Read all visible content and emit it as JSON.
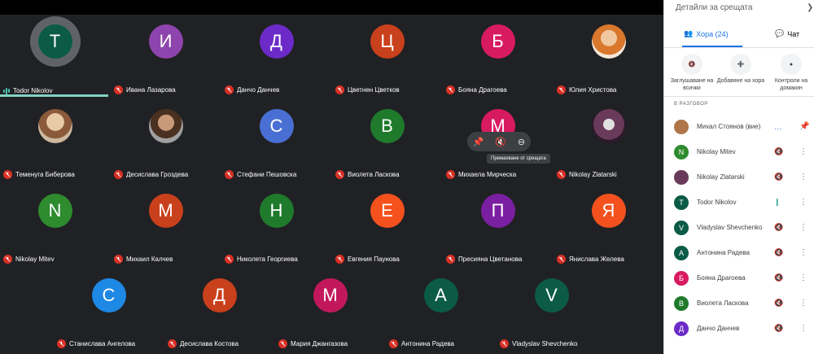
{
  "grid_tiles": [
    {
      "name": "Todor Nikolov",
      "letter": "T",
      "color": "#0b5b46",
      "speaking": true
    },
    {
      "name": "Ивана Лазарова",
      "letter": "И",
      "color": "#8e44ad",
      "speaking": false
    },
    {
      "name": "Данчо Данчев",
      "letter": "Д",
      "color": "#6c2bc8",
      "speaking": false
    },
    {
      "name": "Цветнен Цветков",
      "letter": "Ц",
      "color": "#c9401c",
      "speaking": false
    },
    {
      "name": "Бояна Драгоева",
      "letter": "Б",
      "color": "#d81b60",
      "speaking": false
    },
    {
      "name": "Юлия Христова",
      "photo": "p2",
      "speaking": false
    },
    {
      "name": "Теменуга Биберова",
      "photo": "p1",
      "speaking": false
    },
    {
      "name": "Десислава Гроздева",
      "photo": "p3",
      "speaking": false
    },
    {
      "name": "Стефани Пешовска",
      "letter": "С",
      "color": "#4a6fd4",
      "speaking": false
    },
    {
      "name": "Виолета Ласкова",
      "letter": "В",
      "color": "#1f7a2c",
      "speaking": false
    },
    {
      "name": "Михаела Мирческа",
      "letter": "М",
      "color": "#d81b60",
      "speaking": false
    },
    {
      "name": "Nikolay Zlatarski",
      "photo": "p4",
      "speaking": false
    },
    {
      "name": "Nikolay Mitev",
      "letter": "N",
      "color": "#2e8b2e",
      "speaking": false
    },
    {
      "name": "Михаил Калчев",
      "letter": "М",
      "color": "#c9401c",
      "speaking": false
    },
    {
      "name": "Николета Георгиева",
      "letter": "Н",
      "color": "#1f7a2c",
      "speaking": false
    },
    {
      "name": "Евгения Паунова",
      "letter": "Е",
      "color": "#f4511e",
      "speaking": false
    },
    {
      "name": "Пресияна Цветанова",
      "letter": "П",
      "color": "#7b1fa2",
      "speaking": false
    },
    {
      "name": "Янислава Желева",
      "letter": "Я",
      "color": "#f4511e",
      "speaking": false
    }
  ],
  "bottom_tiles": [
    {
      "name": "Станислава Ангелова",
      "letter": "С",
      "color": "#1e88e5"
    },
    {
      "name": "Десислава Костова",
      "letter": "Д",
      "color": "#c9401c"
    },
    {
      "name": "Мария Джангазова",
      "letter": "М",
      "color": "#c2185b"
    },
    {
      "name": "Антонина Радева",
      "letter": "А",
      "color": "#0b5b46"
    },
    {
      "name": "Vladyslav Shevchenko",
      "letter": "V",
      "color": "#0b5b46"
    }
  ],
  "hover_tooltip": "Премахване от срещата",
  "sidebar": {
    "title": "Детайли за срещата",
    "tab_people": "Хора (24)",
    "tab_chat": "Чат",
    "action_mute_all": "Заглушаване на всички",
    "action_add": "Добавяне на хора",
    "action_host": "Контроли на домакин",
    "section_label": "В РАЗГОВОР",
    "participants": [
      {
        "name": "Михал Стоянов (вие)",
        "letter": "",
        "color": "#b0764a",
        "state": "self"
      },
      {
        "name": "Nikolay Mitev",
        "letter": "N",
        "color": "#2e8b2e",
        "state": "muted"
      },
      {
        "name": "Nikolay Zlatarski",
        "letter": "",
        "color": "#6a3a5a",
        "state": "muted"
      },
      {
        "name": "Todor Nikolov",
        "letter": "T",
        "color": "#0b5b46",
        "state": "speaking"
      },
      {
        "name": "Vladyslav Shevchenko",
        "letter": "V",
        "color": "#0b5b46",
        "state": "muted"
      },
      {
        "name": "Антонина Радева",
        "letter": "А",
        "color": "#0b5b46",
        "state": "muted"
      },
      {
        "name": "Бояна Драгоева",
        "letter": "Б",
        "color": "#d81b60",
        "state": "muted"
      },
      {
        "name": "Виолета Ласкова",
        "letter": "В",
        "color": "#1f7a2c",
        "state": "muted"
      },
      {
        "name": "Данчо Данчев",
        "letter": "Д",
        "color": "#6c2bc8",
        "state": "muted"
      }
    ]
  }
}
